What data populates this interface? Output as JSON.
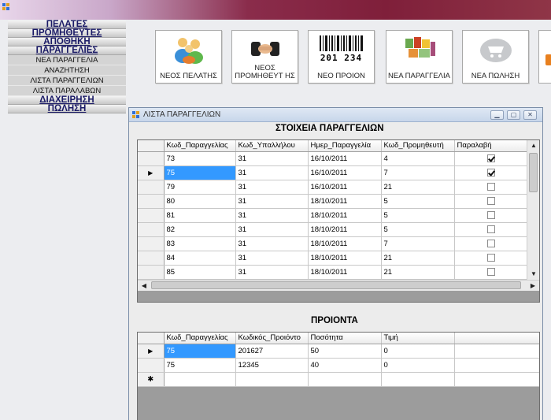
{
  "menu": {
    "items": [
      {
        "label": "ΠΕΛΑΤΕΣ",
        "type": "main"
      },
      {
        "label": "ΠΡΟΜΗΘΕΥΤΕΣ",
        "type": "main"
      },
      {
        "label": "ΑΠΟΘΗΚΗ",
        "type": "main"
      },
      {
        "label": "ΠΑΡΑΓΓΕΛΙΕΣ",
        "type": "main"
      },
      {
        "label": "ΝΕΑ ΠΑΡΑΓΓΕΛΙΑ",
        "type": "sub"
      },
      {
        "label": "ΑΝΑΖΗΤΗΣΗ",
        "type": "sub"
      },
      {
        "label": "ΛΙΣΤΑ ΠΑΡΑΓΓΕΛΙΩΝ",
        "type": "sub"
      },
      {
        "label": "ΛΙΣΤΑ ΠΑΡΑΛΑΒΩΝ",
        "type": "sub"
      },
      {
        "label": "ΔΙΑΧΕΙΡΗΣΗ",
        "type": "main"
      },
      {
        "label": "ΠΩΛΗΣΗ",
        "type": "main"
      }
    ]
  },
  "toolbar": {
    "new_customer": "ΝΕΟΣ ΠΕΛΑΤΗΣ",
    "new_supplier": "ΝΕΟΣ ΠΡΟΜΗΘΕΥΤ ΗΣ",
    "barcode_text": "201 234",
    "new_product": "ΝΕΟ ΠΡΟΙΟΝ",
    "new_order": "ΝΕΑ ΠΑΡΑΓΓΕΛΙΑ",
    "new_sale": "ΝΕΑ ΠΩΛΗΣΗ"
  },
  "child_window": {
    "title": "ΛΙΣΤΑ ΠΑΡΑΓΓΕΛΙΩΝ",
    "orders_heading": "ΣΤΟΙΧΕΙΑ ΠΑΡΑΓΓΕΛΙΩΝ",
    "products_heading": "ΠΡΟΙΟΝΤΑ"
  },
  "orders_grid": {
    "columns": [
      "Κωδ_Παραγγελίας",
      "Κωδ_Υπαλλήλου",
      "Ημερ_Παραγγελία",
      "Κωδ_Προμηθευτή",
      "Παραλαβή"
    ],
    "rows": [
      {
        "c": [
          "73",
          "31",
          "16/10/2011",
          "4"
        ],
        "received": true,
        "current": false
      },
      {
        "c": [
          "75",
          "31",
          "16/10/2011",
          "7"
        ],
        "received": true,
        "current": true
      },
      {
        "c": [
          "79",
          "31",
          "16/10/2011",
          "21"
        ],
        "received": false,
        "current": false
      },
      {
        "c": [
          "80",
          "31",
          "18/10/2011",
          "5"
        ],
        "received": false,
        "current": false
      },
      {
        "c": [
          "81",
          "31",
          "18/10/2011",
          "5"
        ],
        "received": false,
        "current": false
      },
      {
        "c": [
          "82",
          "31",
          "18/10/2011",
          "5"
        ],
        "received": false,
        "current": false
      },
      {
        "c": [
          "83",
          "31",
          "18/10/2011",
          "7"
        ],
        "received": false,
        "current": false
      },
      {
        "c": [
          "84",
          "31",
          "18/10/2011",
          "21"
        ],
        "received": false,
        "current": false
      },
      {
        "c": [
          "85",
          "31",
          "18/10/2011",
          "21"
        ],
        "received": false,
        "current": false
      }
    ]
  },
  "products_grid": {
    "columns": [
      "Κωδ_Παραγγελίας",
      "Κωδικός_Προιόντο",
      "Ποσότητα",
      "Τιμή"
    ],
    "rows": [
      {
        "c": [
          "75",
          "201627",
          "50",
          "0"
        ],
        "current": true
      },
      {
        "c": [
          "75",
          "12345",
          "40",
          "0"
        ],
        "current": false
      }
    ],
    "new_row_marker": "✱"
  }
}
